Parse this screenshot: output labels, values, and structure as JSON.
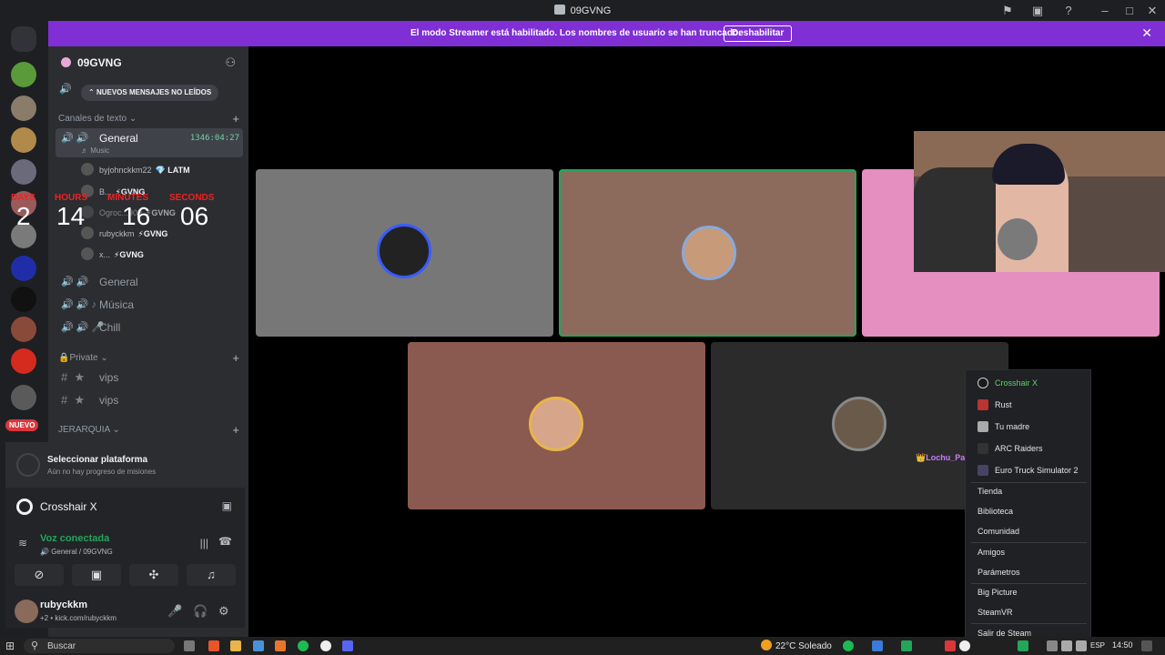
{
  "window": {
    "title": "09GVNG"
  },
  "banner": {
    "text": "El modo Streamer está habilitado. Los nombres de usuario se han truncado.",
    "button": "Deshabilitar"
  },
  "guilds": {
    "new_badge": "NUEVO"
  },
  "server": {
    "name": "09GVNG",
    "unread_pill": "NUEVOS MENSAJES NO LEÍDOS",
    "text_category": "Canales de texto",
    "private_category": "🔒Private",
    "hierarchy_category": "JERARQUIA"
  },
  "channels": {
    "general_active": {
      "name": "General",
      "time": "1346:04:27",
      "sub": "♬ Music"
    },
    "general1": "General",
    "musica": "Música",
    "chill": "Chill",
    "vips1": "vips",
    "vips2": "vips"
  },
  "voice_users": [
    {
      "name": "byjohnckkm22",
      "tag": "💎 LATM"
    },
    {
      "name": "B...",
      "tag": "⚡GVNG"
    },
    {
      "name": "Ogroc...909",
      "tag": "⚡GVNG"
    },
    {
      "name": "rubyckkm",
      "tag": "⚡GVNG"
    },
    {
      "name": "x...",
      "tag": "⚡GVNG"
    }
  ],
  "timer": {
    "days_label": "DAYS",
    "days": "2",
    "hours_label": "HOURS",
    "hours": "14",
    "minutes_label": "MINUTES",
    "minutes": "16",
    "seconds_label": "SECONDS",
    "seconds": "06"
  },
  "panel": {
    "quest_title": "Seleccionar plataforma",
    "quest_sub": "Aún no hay progreso de misiones",
    "activity": "Crosshair X",
    "voice_title": "Voz conectada",
    "voice_sub": "General / 09GVNG",
    "user_name": "rubyckkm",
    "user_status": "+2 • kick.com/rubyckkm"
  },
  "stage": {
    "nameplate": "👑Lochu_Pai..."
  },
  "steam_menu": {
    "games": [
      "Crosshair X",
      "Rust",
      "Tu madre",
      "ARC Raiders",
      "Euro Truck Simulator 2"
    ],
    "group1": [
      "Tienda",
      "Biblioteca",
      "Comunidad"
    ],
    "group2": [
      "Amigos",
      "Parámetros"
    ],
    "group3": [
      "Big Picture",
      "SteamVR"
    ],
    "exit": "Salir de Steam"
  },
  "taskbar": {
    "search_placeholder": "Buscar",
    "weather": "22°C  Soleado",
    "language": "ESP",
    "time": "14:50"
  },
  "colors": {
    "accent": "#7f2fd4",
    "voice_green": "#23a55a"
  }
}
